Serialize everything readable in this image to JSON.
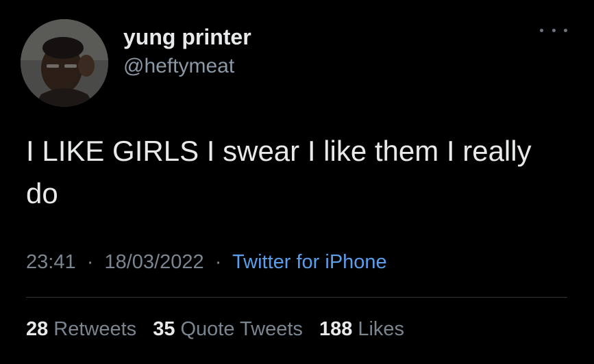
{
  "tweet": {
    "display_name": "yung printer",
    "handle": "@heftymeat",
    "text": "I LIKE GIRLS I swear I like them I really do",
    "time": "23:41",
    "separator": "·",
    "date": "18/03/2022",
    "source": "Twitter for iPhone"
  },
  "stats": {
    "retweets_count": "28",
    "retweets_label": "Retweets",
    "quotes_count": "35",
    "quotes_label": "Quote Tweets",
    "likes_count": "188",
    "likes_label": "Likes"
  },
  "icons": {
    "more": "more-horizontal-icon"
  },
  "colors": {
    "background": "#000000",
    "text": "#e7e9ea",
    "secondary": "#7b858f",
    "link": "#5b9ee9",
    "divider": "#2f3336"
  }
}
